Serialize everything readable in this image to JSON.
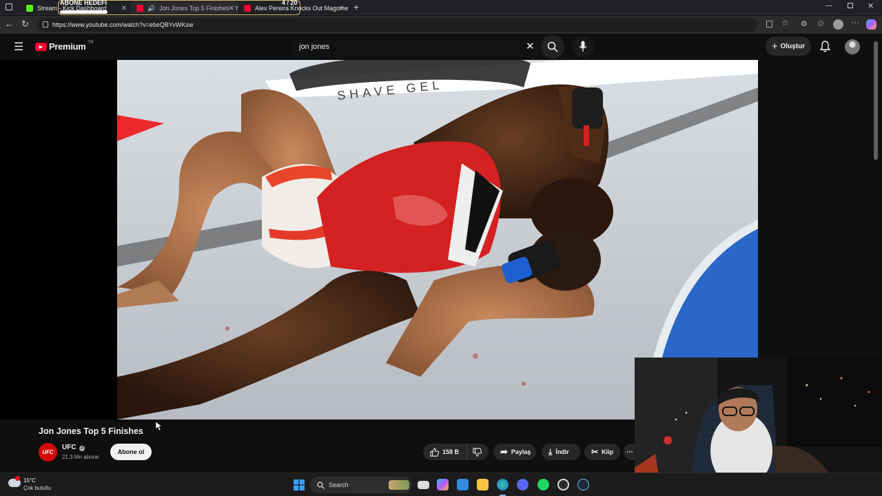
{
  "browser": {
    "tabs": [
      {
        "title": "Stream - Kick Dashboard",
        "favicon_color": "#53fc18"
      },
      {
        "title": "Jon Jones Top 5 Finishes - Yo",
        "favicon_color": "#ff0033"
      },
      {
        "title": "Alex Pereira Knocks Out Magome",
        "favicon_color": "#ff0033"
      }
    ],
    "url": "https://www.youtube.com/watch?v=ebeQBYvWKsw"
  },
  "overlay": {
    "goal_label": "ABONE HEDEFİ",
    "goal_progress": "4 / 20",
    "goal_fraction": 0.2
  },
  "youtube": {
    "logo_text": "Premium",
    "logo_region": "TR",
    "search_query": "jon jones",
    "create_label": "Oluştur"
  },
  "video": {
    "title": "Jon Jones Top 5 Finishes",
    "channel_name": "UFC",
    "channel_avatar_text": "UFC",
    "subscribers": "21,3 Mn abone",
    "subscribe_label": "Abone ol",
    "likes": "158 B",
    "share_label": "Paylaş",
    "download_label": "İndir",
    "clip_label": "Klip"
  },
  "taskbar": {
    "weather_temp": "15°C",
    "weather_desc": "Çok bulutlu",
    "search_label": "Search"
  },
  "colors": {
    "youtube_red": "#ff0033",
    "kick_green": "#53fc18",
    "background": "#0f0f0f"
  }
}
